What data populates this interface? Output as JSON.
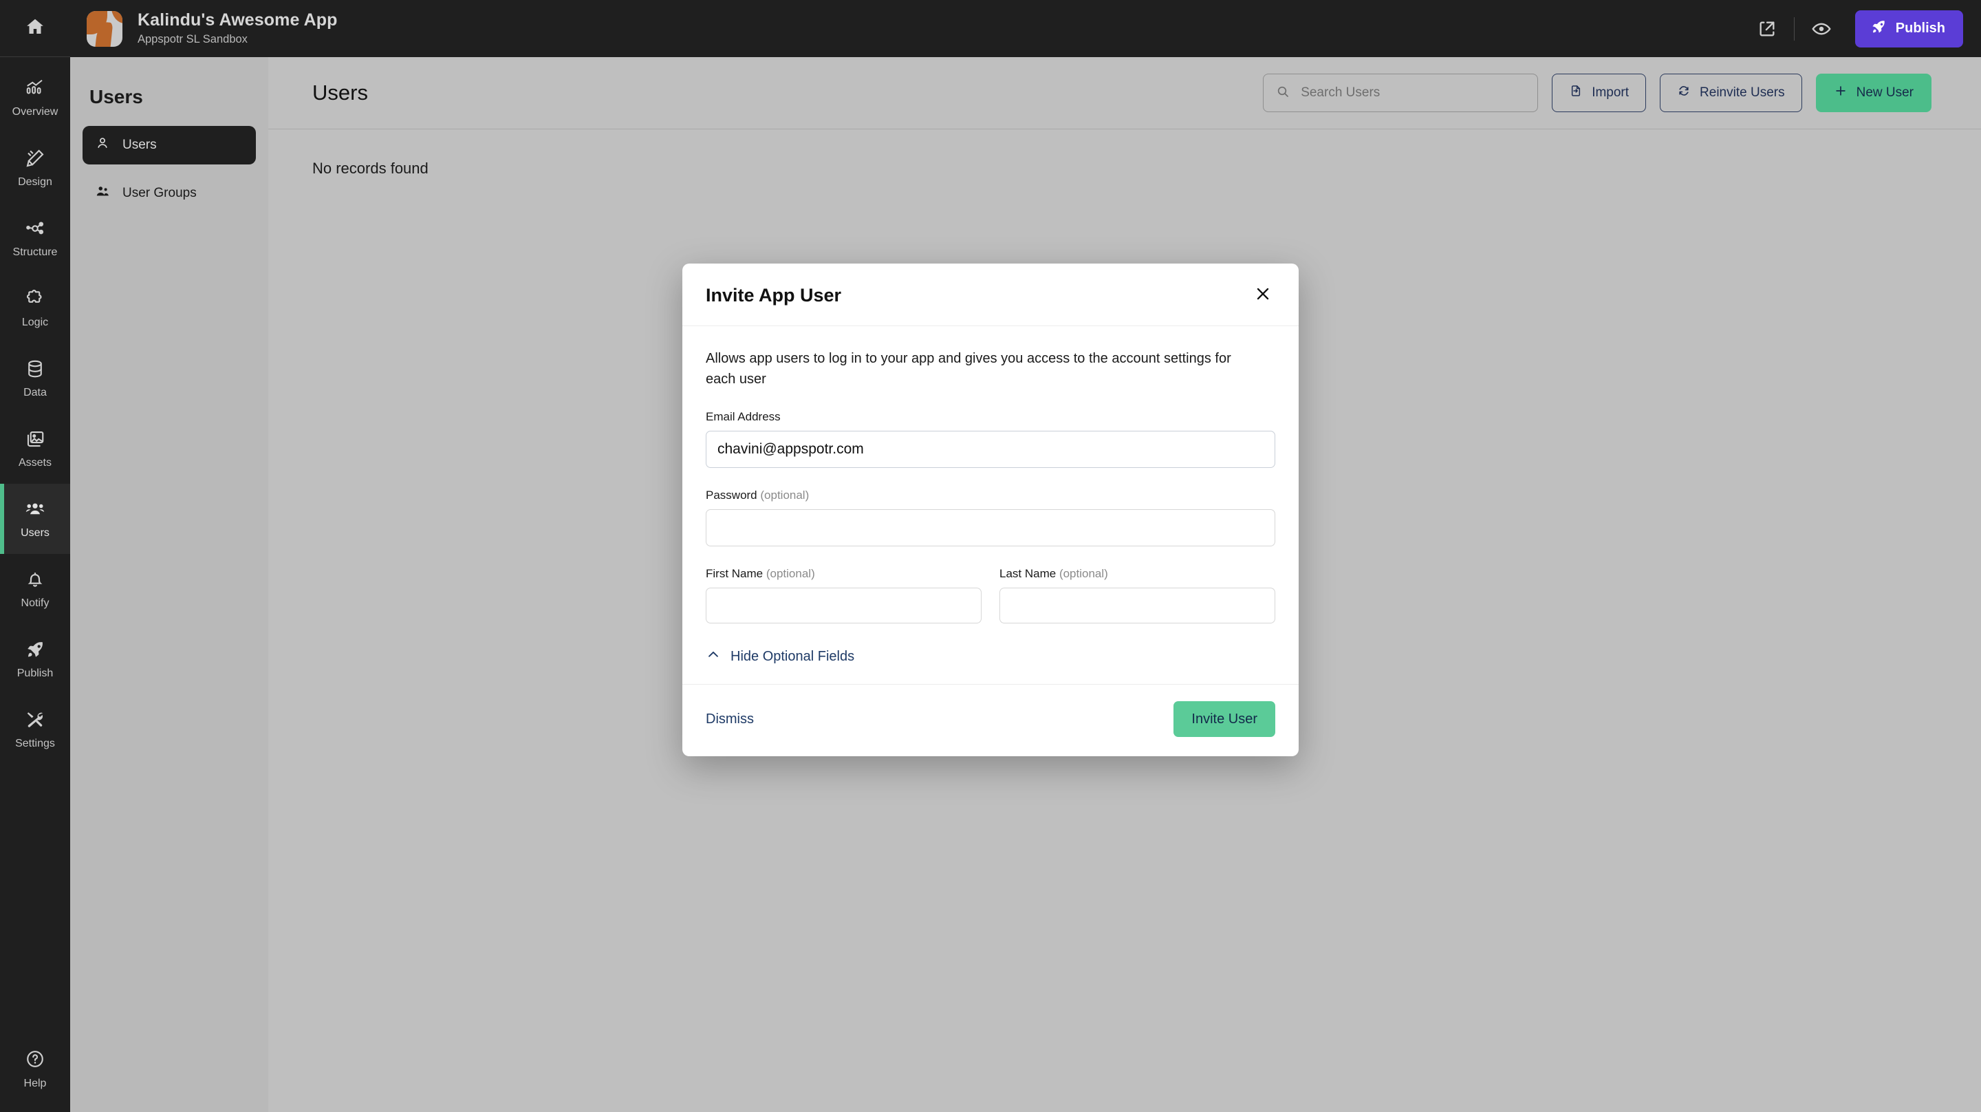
{
  "topbar": {
    "app_title": "Kalindu's Awesome App",
    "app_subtitle": "Appspotr SL Sandbox",
    "share_icon": "share-icon",
    "preview_icon": "eye-icon",
    "publish_label": "Publish",
    "publish_icon": "rocket-icon",
    "publish_color": "#5b3dd6"
  },
  "rail": {
    "home_icon": "home-icon",
    "items": [
      {
        "label": "Overview",
        "icon": "chart-icon",
        "active": false
      },
      {
        "label": "Design",
        "icon": "pencil-ruler-icon",
        "active": false
      },
      {
        "label": "Structure",
        "icon": "nodes-icon",
        "active": false
      },
      {
        "label": "Logic",
        "icon": "puzzle-icon",
        "active": false
      },
      {
        "label": "Data",
        "icon": "database-icon",
        "active": false
      },
      {
        "label": "Assets",
        "icon": "image-icon",
        "active": false
      },
      {
        "label": "Users",
        "icon": "users-icon",
        "active": true
      },
      {
        "label": "Notify",
        "icon": "bell-icon",
        "active": false
      },
      {
        "label": "Publish",
        "icon": "rocket-icon",
        "active": false
      },
      {
        "label": "Settings",
        "icon": "tools-icon",
        "active": false
      }
    ],
    "help_label": "Help",
    "help_icon": "question-circle-icon",
    "active_accent": "#4fbd8b"
  },
  "subnav": {
    "title": "Users",
    "items": [
      {
        "label": "Users",
        "icon": "user-icon",
        "active": true
      },
      {
        "label": "User Groups",
        "icon": "user-group-icon",
        "active": false
      }
    ]
  },
  "main": {
    "page_title": "Users",
    "empty_message": "No records found",
    "search": {
      "value": "",
      "placeholder": "Search Users",
      "icon": "search-icon"
    },
    "import_label": "Import",
    "import_icon": "import-icon",
    "reinvite_label": "Reinvite Users",
    "reinvite_icon": "refresh-icon",
    "new_user_label": "New User",
    "new_user_icon": "plus-icon",
    "new_user_color": "#4cbd8a"
  },
  "modal": {
    "title": "Invite App User",
    "close_icon": "close-icon",
    "description": "Allows app users to log in to your app and gives you access to the account settings for each user",
    "fields": {
      "email": {
        "label": "Email Address",
        "optional": "",
        "value": "chavini@appspotr.com",
        "placeholder": ""
      },
      "password": {
        "label": "Password",
        "optional": "(optional)",
        "value": "",
        "placeholder": ""
      },
      "first_name": {
        "label": "First Name",
        "optional": "(optional)",
        "value": "",
        "placeholder": ""
      },
      "last_name": {
        "label": "Last Name",
        "optional": "(optional)",
        "value": "",
        "placeholder": ""
      }
    },
    "toggle_optional_label": "Hide Optional Fields",
    "toggle_optional_icon": "chevron-up-icon",
    "dismiss_label": "Dismiss",
    "submit_label": "Invite User",
    "submit_color": "#5bcb98"
  }
}
